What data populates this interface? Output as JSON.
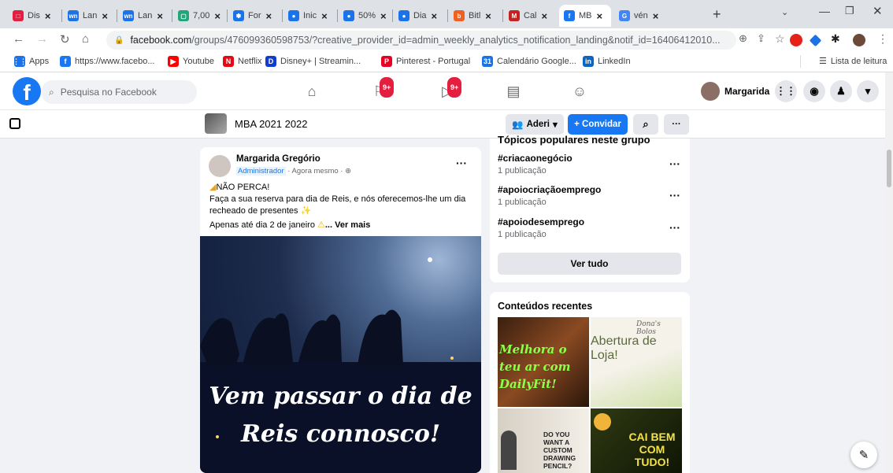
{
  "browser": {
    "tabs": [
      {
        "label": "Dis",
        "color": "#e41e3f",
        "glyph": "□"
      },
      {
        "label": "Lan",
        "color": "#1a73e8",
        "glyph": "wn"
      },
      {
        "label": "Lan",
        "color": "#1a73e8",
        "glyph": "wn"
      },
      {
        "label": "7,00",
        "color": "#21a67a",
        "glyph": "▢"
      },
      {
        "label": "For",
        "color": "#1a73e8",
        "glyph": "❃"
      },
      {
        "label": "Inic",
        "color": "#1a73e8",
        "glyph": "●"
      },
      {
        "label": "50%",
        "color": "#1a73e8",
        "glyph": "●"
      },
      {
        "label": "Dia",
        "color": "#1a73e8",
        "glyph": "●"
      },
      {
        "label": "Bitl",
        "color": "#ee6123",
        "glyph": "b"
      },
      {
        "label": "Cal",
        "color": "#c5221f",
        "glyph": "M"
      },
      {
        "label": "MB",
        "color": "#1877f2",
        "glyph": "f"
      },
      {
        "label": "vén",
        "color": "#4285f4",
        "glyph": "G"
      }
    ],
    "new_tab": "+",
    "url_host": "facebook.com",
    "url_path": "/groups/476099360598753/?creative_provider_id=admin_weekly_analytics_notification_landing&notif_id=16406412010...",
    "bookmarks": [
      {
        "label": "Apps",
        "color": "#1a73e8",
        "glyph": "⋮⋮"
      },
      {
        "label": "https://www.facebo...",
        "color": "#1877f2",
        "glyph": "f"
      },
      {
        "label": "Youtube",
        "color": "#ff0000",
        "glyph": "▶"
      },
      {
        "label": "Netflix",
        "color": "#e50914",
        "glyph": "N"
      },
      {
        "label": "Disney+ | Streamin...",
        "color": "#113ccf",
        "glyph": "D"
      },
      {
        "label": "Pinterest - Portugal",
        "color": "#e60023",
        "glyph": "P"
      },
      {
        "label": "Calendário Google...",
        "color": "#1a73e8",
        "glyph": "31"
      },
      {
        "label": "LinkedIn",
        "color": "#0a66c2",
        "glyph": "in"
      }
    ],
    "reading_list": "Lista de leitura"
  },
  "facebook": {
    "search_placeholder": "Pesquisa no Facebook",
    "groups_badge": "9+",
    "watch_badge": "9+",
    "profile_name": "Margarida"
  },
  "group": {
    "name": "MBA 2021 2022",
    "joined_label": "Aderi",
    "invite_label": "+ Convidar",
    "more": "···"
  },
  "post": {
    "author": "Margarida Gregório",
    "role": "Administrador",
    "time": "· Agora mesmo ·",
    "line1": "NÃO PERCA!",
    "line2": "Faça a sua reserva para dia de Reis, e nós oferecemos-lhe um dia recheado de presentes",
    "line3": "Apenas até dia 2 de janeiro",
    "see_more": "... Ver mais",
    "image_text_1": "Vem passar o dia de",
    "image_text_2": "Reis connosco!"
  },
  "topics": {
    "header": "Tópicos populares neste grupo",
    "items": [
      {
        "tag": "#criacaonegócio",
        "count": "1 publicação"
      },
      {
        "tag": "#apoiocriaçãoemprego",
        "count": "1 publicação"
      },
      {
        "tag": "#apoiodesemprego",
        "count": "1 publicação"
      }
    ],
    "see_all": "Ver tudo"
  },
  "recent": {
    "header": "Conteúdos recentes",
    "thumb1": "Melhora o teu ar com DailyFit!",
    "thumb2_script": "Dona's Bolos",
    "thumb2": "Abertura de Loja!",
    "thumb3": "DO YOU WANT A CUSTOM DRAWING PENCIL?",
    "thumb4": "CAI BEM COM TUDO!"
  }
}
